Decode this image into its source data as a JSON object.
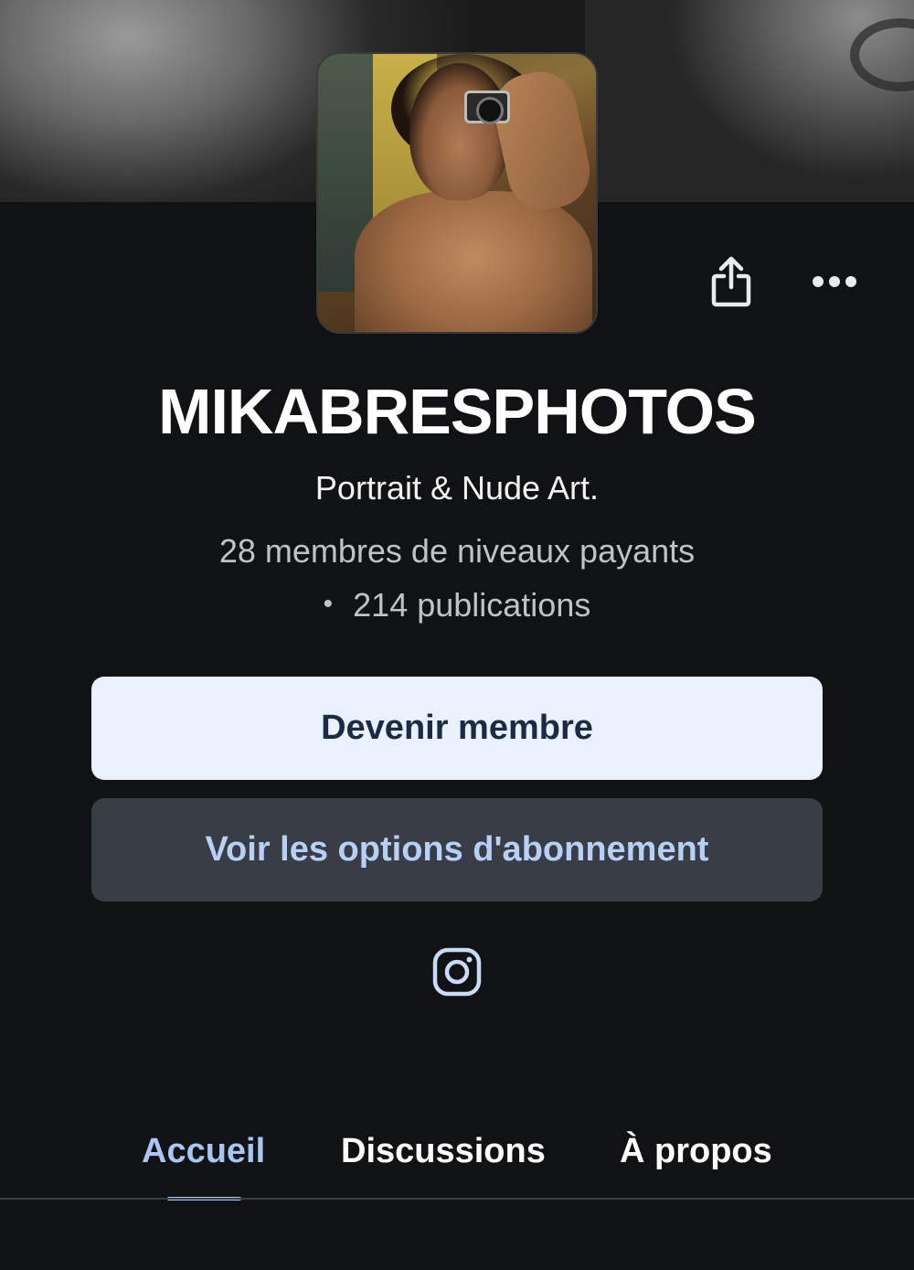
{
  "profile": {
    "name": "MIKABRESPHOTOS",
    "tagline": "Portrait & Nude Art.",
    "paid_members": "28 membres de niveaux payants",
    "posts_bullet": "•",
    "posts": "214 publications"
  },
  "actions": {
    "join_label": "Devenir membre",
    "options_label": "Voir les options d'abonnement"
  },
  "icons": {
    "share": "share-icon",
    "more": "more-icon",
    "instagram": "instagram-icon"
  },
  "tabs": [
    {
      "label": "Accueil",
      "active": true
    },
    {
      "label": "Discussions",
      "active": false
    },
    {
      "label": "À propos",
      "active": false
    }
  ],
  "colors": {
    "background": "#111214",
    "primary_button": "#eaf1fd",
    "secondary_button": "#393d46",
    "accent": "#a9c6f2"
  }
}
